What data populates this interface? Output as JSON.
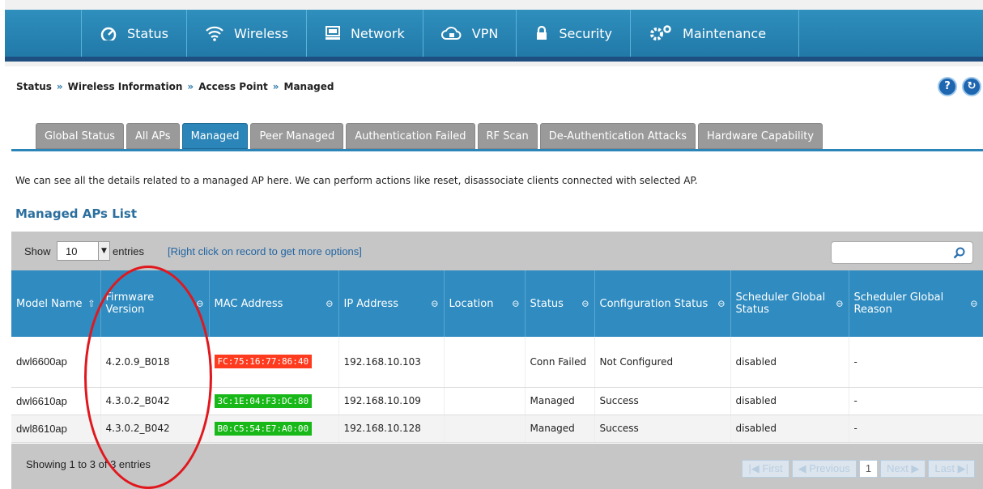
{
  "nav": [
    {
      "label": "Status",
      "icon": "dashboard-icon"
    },
    {
      "label": "Wireless",
      "icon": "wifi-icon"
    },
    {
      "label": "Network",
      "icon": "monitor-icon"
    },
    {
      "label": "VPN",
      "icon": "cloud-lock-icon"
    },
    {
      "label": "Security",
      "icon": "lock-icon"
    },
    {
      "label": "Maintenance",
      "icon": "gears-icon"
    }
  ],
  "breadcrumb": [
    "Status",
    "Wireless Information",
    "Access Point",
    "Managed"
  ],
  "breadcrumb_sep": "»",
  "help_label": "?",
  "refresh_label": "↻",
  "tabs": [
    "Global Status",
    "All APs",
    "Managed",
    "Peer Managed",
    "Authentication Failed",
    "RF Scan",
    "De-Authentication Attacks",
    "Hardware Capability"
  ],
  "active_tab": "Managed",
  "description": "We can see all the details related to a managed AP here. We can perform actions like reset, disassociate clients connected with selected AP.",
  "list_title": "Managed APs List",
  "toolbar": {
    "show": "Show",
    "entries_value": "10",
    "entries": "entries",
    "hint": "[Right click on record to get more options]"
  },
  "table": {
    "headers": [
      {
        "label": "Model Name",
        "sort": "⇧"
      },
      {
        "label": "Firmware Version",
        "sort": "⊖"
      },
      {
        "label": "MAC Address",
        "sort": "⊖"
      },
      {
        "label": "IP Address",
        "sort": "⊖"
      },
      {
        "label": "Location",
        "sort": "⊖"
      },
      {
        "label": "Status",
        "sort": "⊖"
      },
      {
        "label": "Configuration Status",
        "sort": "⊖"
      },
      {
        "label": "Scheduler Global Status",
        "sort": "⊖"
      },
      {
        "label": "Scheduler Global Reason",
        "sort": "⊖"
      }
    ],
    "rows": [
      {
        "model": "dwl6600ap",
        "firmware": "4.2.0.9_B018",
        "mac": "FC:75:16:77:86:40",
        "mac_color": "#ff3b1f",
        "ip": "192.168.10.103",
        "location": "",
        "status": "Conn Failed",
        "config": "Not Configured",
        "sched_status": "disabled",
        "sched_reason": "-"
      },
      {
        "model": "dwl6610ap",
        "firmware": "4.3.0.2_B042",
        "mac": "3C:1E:04:F3:DC:80",
        "mac_color": "#17b817",
        "ip": "192.168.10.109",
        "location": "",
        "status": "Managed",
        "config": "Success",
        "sched_status": "disabled",
        "sched_reason": "-"
      },
      {
        "model": "dwl8610ap",
        "firmware": "4.3.0.2_B042",
        "mac": "B0:C5:54:E7:A0:00",
        "mac_color": "#17b817",
        "ip": "192.168.10.128",
        "location": "",
        "status": "Managed",
        "config": "Success",
        "sched_status": "disabled",
        "sched_reason": "-"
      }
    ]
  },
  "footer": {
    "info": "Showing 1 to 3 of 3 entries",
    "pager": [
      "First",
      "Previous",
      "1",
      "Next",
      "Last"
    ],
    "current_page": "1"
  },
  "colors": {
    "nav": "#2a86b8",
    "active_tab": "#2c85b8",
    "annotation": "#e0181e"
  }
}
